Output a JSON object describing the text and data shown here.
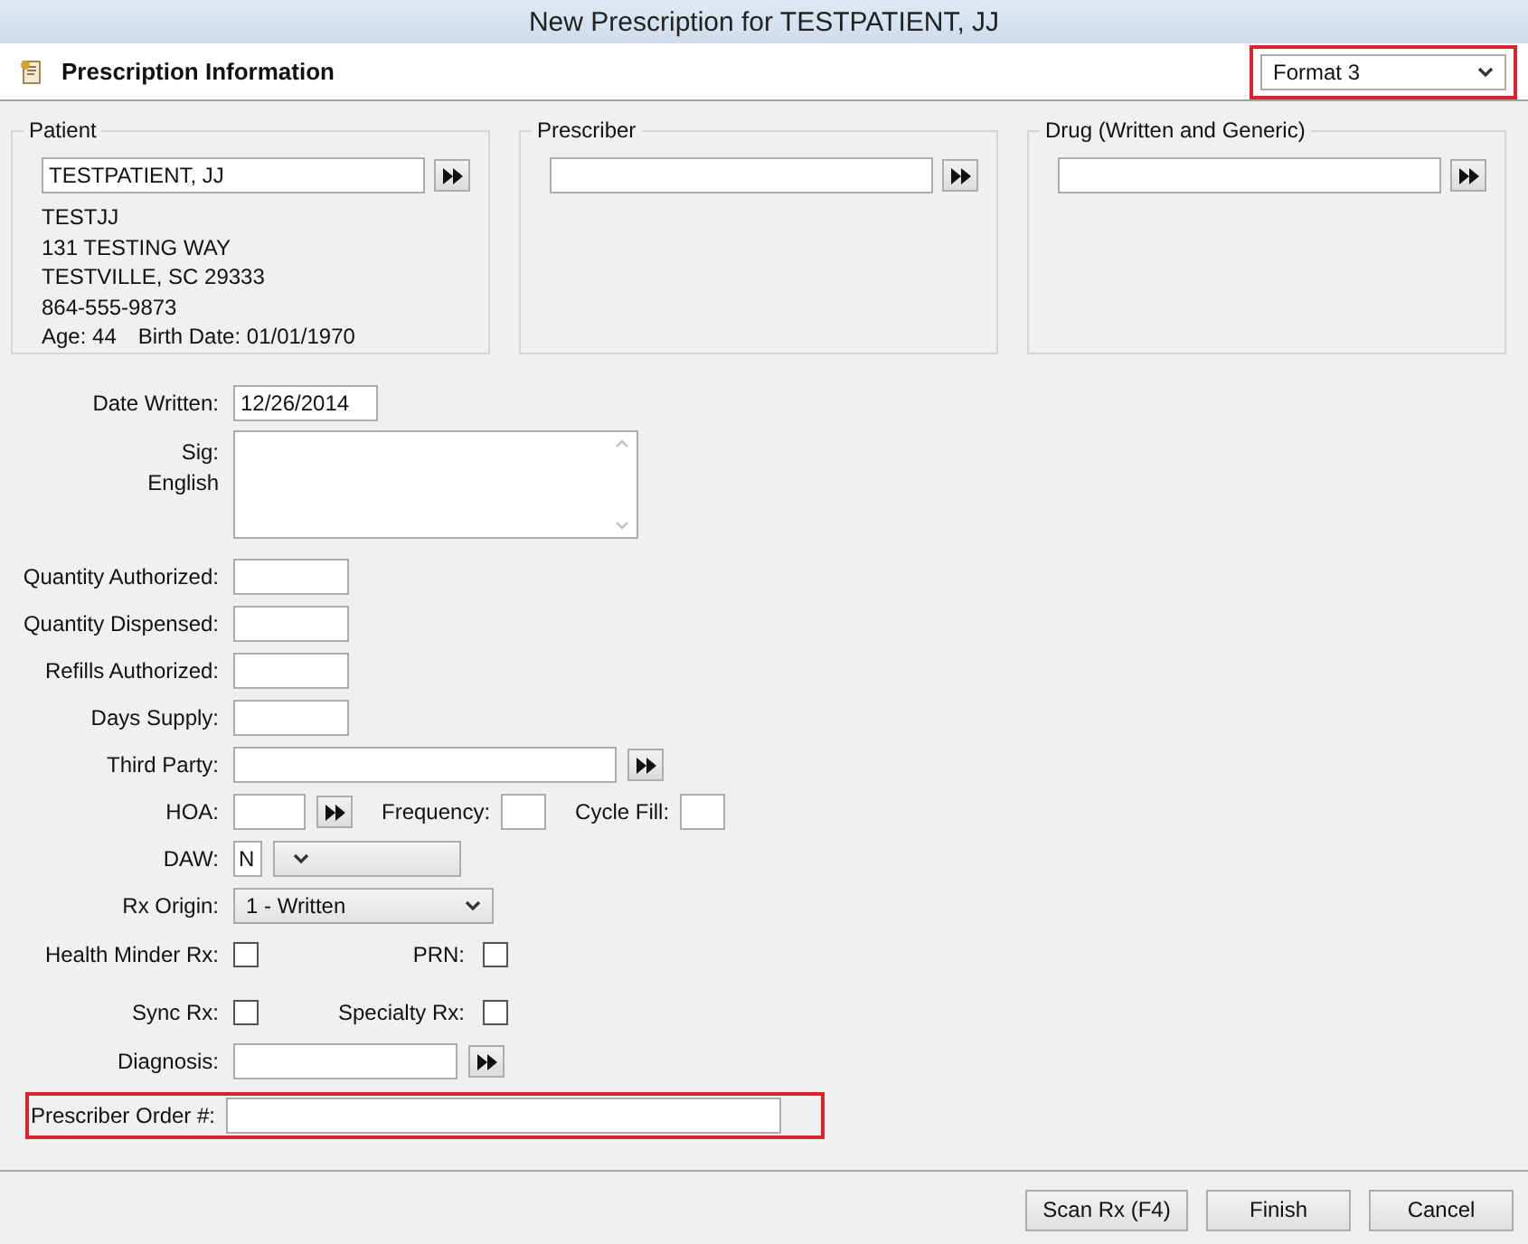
{
  "window": {
    "title": "New Prescription for TESTPATIENT, JJ"
  },
  "header": {
    "title": "Prescription Information",
    "format": {
      "value": "Format 3",
      "highlighted": true
    }
  },
  "patient": {
    "title": "Patient",
    "value": "TESTPATIENT, JJ",
    "lines": [
      "TESTJJ",
      "131 TESTING WAY",
      "TESTVILLE, SC 29333",
      "864-555-9873"
    ],
    "age": "Age: 44",
    "birth_date": "Birth Date: 01/01/1970"
  },
  "prescriber": {
    "title": "Prescriber"
  },
  "drug": {
    "title": "Drug (Written and Generic)"
  },
  "form": {
    "date_written": {
      "label": "Date Written:",
      "value": "12/26/2014"
    },
    "sig": {
      "label": "Sig:",
      "sublabel": "English"
    },
    "quantities": [
      {
        "label": "Quantity Authorized:"
      },
      {
        "label": "Quantity Dispensed:"
      },
      {
        "label": "Refills Authorized:"
      },
      {
        "label": "Days Supply:"
      }
    ],
    "third_party": {
      "label": "Third Party:"
    },
    "hoa": {
      "label": "HOA:"
    },
    "frequency": {
      "label": "Frequency:"
    },
    "cycle_fill": {
      "label": "Cycle Fill:"
    },
    "daw": {
      "label": "DAW:",
      "code": "N"
    },
    "rx_origin": {
      "label": "Rx Origin:",
      "value": "1 - Written"
    },
    "checks": [
      {
        "label": "Health Minder Rx:",
        "checked": false
      },
      {
        "label": "PRN:",
        "checked": false
      },
      {
        "label": "Sync Rx:",
        "checked": false
      },
      {
        "label": "Specialty Rx:",
        "checked": false
      }
    ],
    "diagnosis": {
      "label": "Diagnosis:"
    },
    "prescriber_order": {
      "label": "Prescriber Order #:",
      "highlighted": true
    }
  },
  "buttons": [
    {
      "label": "Scan Rx (F4)"
    },
    {
      "label": "Finish"
    },
    {
      "label": "Cancel"
    }
  ]
}
